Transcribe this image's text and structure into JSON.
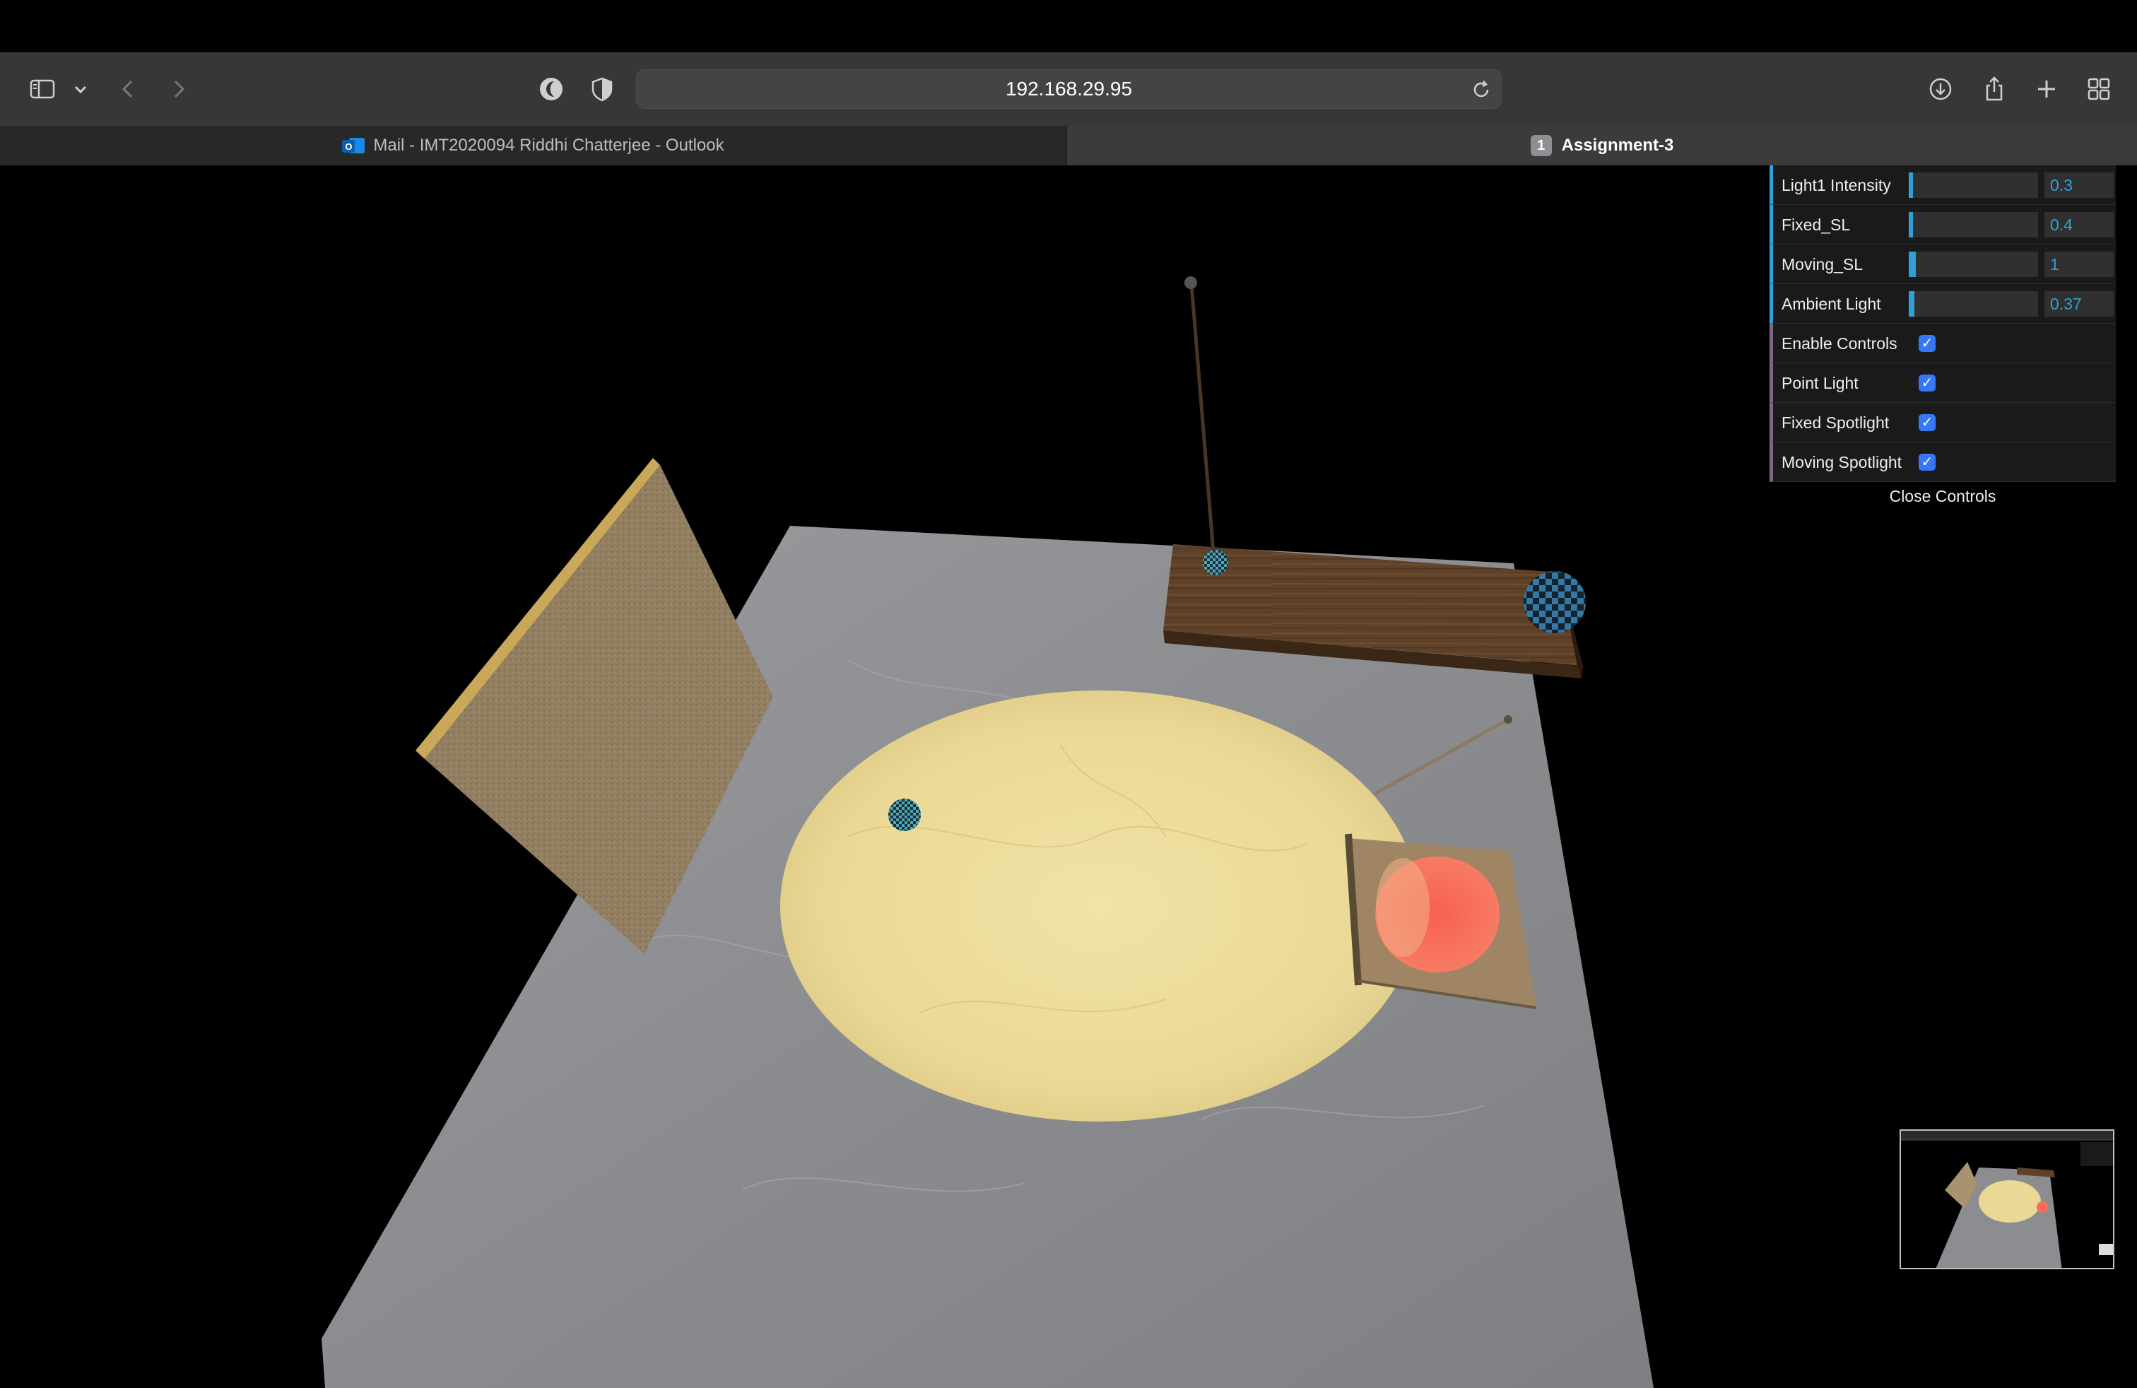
{
  "browser": {
    "url": "192.168.29.95",
    "tabs": [
      {
        "label": "Mail - IMT2020094 Riddhi Chatterjee - Outlook",
        "active": false,
        "icon": "outlook-icon"
      },
      {
        "label": "Assignment-3",
        "active": true,
        "badge": "1"
      }
    ],
    "toolbar_icons": [
      "sidebar-icon",
      "chevron-down-icon",
      "back-icon",
      "forward-icon",
      "dark-mode-icon",
      "privacy-shield-icon",
      "reload-icon",
      "download-icon",
      "share-icon",
      "new-tab-icon",
      "tab-overview-icon"
    ]
  },
  "controls": {
    "sliders": [
      {
        "label": "Light1 Intensity",
        "value": "0.3",
        "fill": 0.03
      },
      {
        "label": "Fixed_SL",
        "value": "0.4",
        "fill": 0.03
      },
      {
        "label": "Moving_SL",
        "value": "1",
        "fill": 0.05
      },
      {
        "label": "Ambient Light",
        "value": "0.37",
        "fill": 0.04
      }
    ],
    "toggles": [
      {
        "label": "Enable Controls",
        "checked": true
      },
      {
        "label": "Point Light",
        "checked": true
      },
      {
        "label": "Fixed Spotlight",
        "checked": true
      },
      {
        "label": "Moving Spotlight",
        "checked": true
      }
    ],
    "close_label": "Close Controls",
    "colors": {
      "accent": "#2fa1d6",
      "bool_accent": "#806787",
      "checkbox": "#3478f6"
    }
  },
  "scene": {
    "objects": [
      "floor-plane",
      "sandstone-wall",
      "wooden-shelf",
      "lamp-pole",
      "checkered-sphere-large",
      "checkered-sphere-small",
      "checkered-sphere-floor",
      "spotlight-circle",
      "red-light-spot",
      "scroll-plane",
      "rod"
    ],
    "colors": {
      "floor": "#8e8f92",
      "spotlight": "#eddc9a",
      "red_spot": "#ff6a5a",
      "wall": "#a89270",
      "shelf": "#5e4128"
    }
  }
}
